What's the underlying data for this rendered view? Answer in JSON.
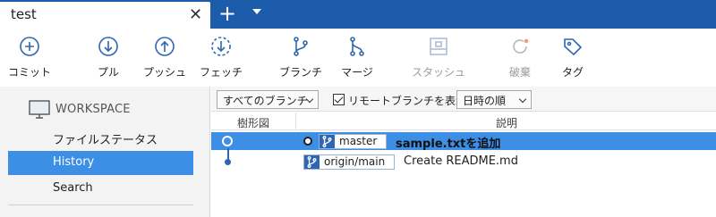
{
  "tab": {
    "title": "test",
    "close": "✕",
    "add": "+"
  },
  "toolbar": {
    "commit": "コミット",
    "pull": "プル",
    "push": "プッシュ",
    "fetch": "フェッチ",
    "branch": "ブランチ",
    "merge": "マージ",
    "stash": "スタッシュ",
    "discard": "破棄",
    "tag": "タグ"
  },
  "sidebar": {
    "workspace": "WORKSPACE",
    "items": [
      "ファイルステータス",
      "History",
      "Search"
    ]
  },
  "filters": {
    "branches": "すべてのブランチ",
    "show_remote": "リモートブランチを表示",
    "show_remote_checked": true,
    "order": "日時の順"
  },
  "columns": {
    "graph": "樹形図",
    "description": "説明"
  },
  "commits": [
    {
      "branch": "master",
      "message": "sample.txtを追加",
      "selected": true
    },
    {
      "branch": "origin/main",
      "message": "Create README.md",
      "selected": false
    }
  ],
  "colors": {
    "accent": "#1d5bab",
    "selection": "#3d8ee5",
    "branch_icon": "#2f66b3"
  }
}
